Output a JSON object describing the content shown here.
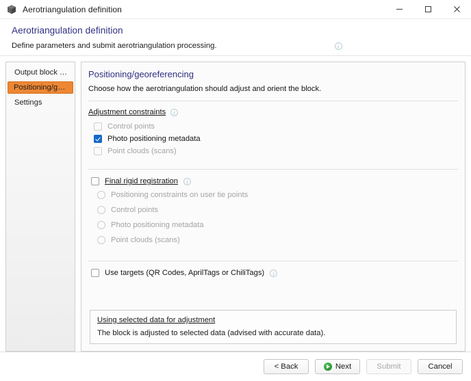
{
  "window": {
    "title": "Aerotriangulation definition",
    "app_icon": "cube-icon",
    "controls": {
      "minimize": "—",
      "maximize": "□",
      "close": "✕"
    }
  },
  "header": {
    "title": "Aerotriangulation definition",
    "subtitle": "Define parameters and submit aerotriangulation processing.",
    "info_icon": "info-icon"
  },
  "sidebar": {
    "items": [
      {
        "label": "Output block name",
        "selected": false
      },
      {
        "label": "Positioning/georefere...",
        "selected": true
      },
      {
        "label": "Settings",
        "selected": false
      }
    ]
  },
  "panel": {
    "title": "Positioning/georeferencing",
    "subtitle": "Choose how the aerotriangulation should adjust and orient the block.",
    "adjustment_constraints": {
      "section_label": "Adjustment constraints",
      "info_icon": "info-icon",
      "options": [
        {
          "label": "Control points",
          "checked": false,
          "disabled": true
        },
        {
          "label": "Photo positioning metadata",
          "checked": true,
          "disabled": false
        },
        {
          "label": "Point clouds (scans)",
          "checked": false,
          "disabled": true
        }
      ]
    },
    "final_rigid_registration": {
      "label": "Final rigid registration",
      "checked": false,
      "info_icon": "info-icon",
      "options": [
        {
          "label": "Positioning constraints on user tie points",
          "selected": false,
          "disabled": true
        },
        {
          "label": "Control points",
          "selected": false,
          "disabled": true
        },
        {
          "label": "Photo positioning metadata",
          "selected": false,
          "disabled": true
        },
        {
          "label": "Point clouds (scans)",
          "selected": false,
          "disabled": true
        }
      ]
    },
    "use_targets": {
      "label": "Use targets (QR Codes, AprilTags or ChiliTags)",
      "checked": false,
      "info_icon": "info-icon"
    },
    "infobox": {
      "title": "Using selected data for adjustment",
      "text": "The block is adjusted to selected data (advised with accurate data)."
    }
  },
  "footer": {
    "buttons": [
      {
        "label": "< Back",
        "disabled": false,
        "icon": null
      },
      {
        "label": "Next",
        "disabled": false,
        "icon": "green-arrow-right-icon"
      },
      {
        "label": "Submit",
        "disabled": true,
        "icon": null
      },
      {
        "label": "Cancel",
        "disabled": false,
        "icon": null
      }
    ]
  },
  "colors": {
    "accent_heading": "#2f2f82",
    "selected_sidebar": "#ed8733",
    "checkbox_checked": "#1769c9",
    "next_icon_green": "#2f9b36"
  }
}
